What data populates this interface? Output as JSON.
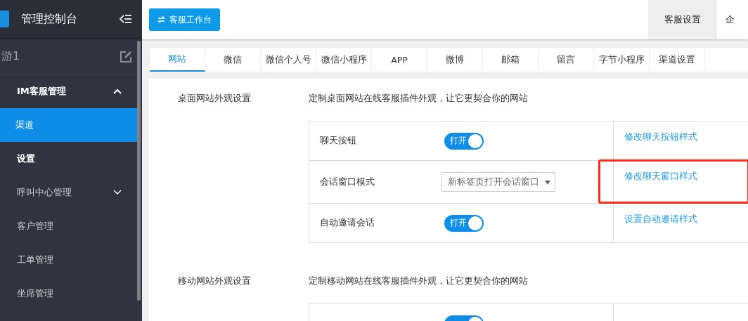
{
  "sidebar": {
    "title": "管理控制台",
    "user": "游1",
    "items": [
      {
        "label": "IM客服管理",
        "kind": "group",
        "expanded": true,
        "selected": false
      },
      {
        "label": "渠道",
        "kind": "item",
        "selected": true
      },
      {
        "label": "设置",
        "kind": "item",
        "selected": false
      },
      {
        "label": "呼叫中心管理",
        "kind": "group",
        "expanded": false,
        "selected": false
      },
      {
        "label": "客户管理",
        "kind": "item",
        "selected": false
      },
      {
        "label": "工单管理",
        "kind": "item",
        "selected": false
      },
      {
        "label": "坐席管理",
        "kind": "item",
        "selected": false
      }
    ]
  },
  "topbar": {
    "button": "客服工作台",
    "tabs": [
      {
        "label": "客服设置",
        "selected": true
      },
      {
        "label": "企",
        "selected": false
      }
    ]
  },
  "channel_tabs": [
    {
      "label": "网站",
      "selected": true
    },
    {
      "label": "微信",
      "selected": false
    },
    {
      "label": "微信个人号",
      "selected": false
    },
    {
      "label": "微信小程序",
      "selected": false
    },
    {
      "label": "APP",
      "selected": false
    },
    {
      "label": "微博",
      "selected": false
    },
    {
      "label": "邮箱",
      "selected": false
    },
    {
      "label": "留言",
      "selected": false
    },
    {
      "label": "字节小程序",
      "selected": false
    },
    {
      "label": "渠道设置",
      "selected": false
    }
  ],
  "sections": [
    {
      "title": "桌面网站外观设置",
      "description": "定制桌面网站在线客服插件外观，让它更契合你的网站",
      "rows": [
        {
          "label": "聊天按钮",
          "kind": "toggle",
          "on": true,
          "toggle_text": "打开",
          "link": "修改聊天按钮样式",
          "highlighted": false
        },
        {
          "label": "会话窗口模式",
          "kind": "select",
          "value": "新标签页打开会话窗口",
          "link": "修改聊天窗口样式",
          "highlighted": true
        },
        {
          "label": "自动邀请会话",
          "kind": "toggle",
          "on": true,
          "toggle_text": "打开",
          "link": "设置自动邀请样式",
          "highlighted": false
        }
      ]
    },
    {
      "title": "移动网站外观设置",
      "description": "定制移动网站在线客服插件外观，让它更契合你的网站",
      "rows": [
        {
          "kind": "toggle",
          "on": true,
          "highlighted": false
        }
      ]
    }
  ]
}
